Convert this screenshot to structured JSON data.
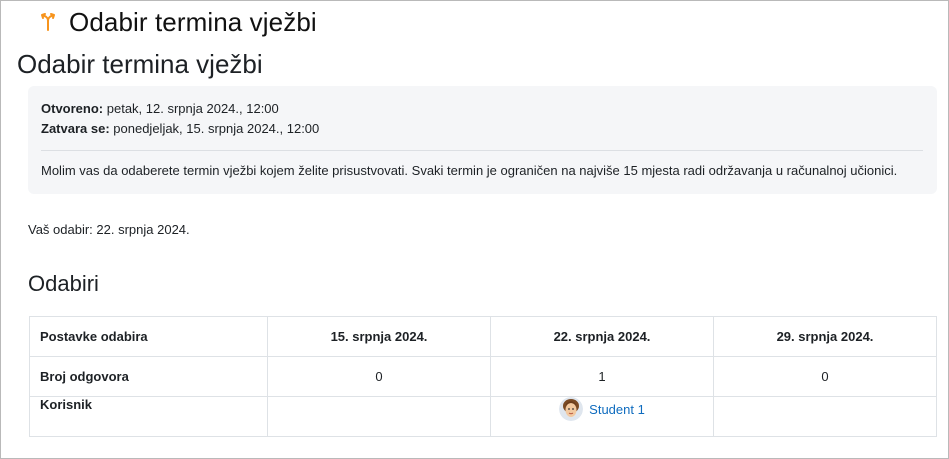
{
  "header": {
    "icon": "choice-icon",
    "title": "Odabir termina vježbi"
  },
  "activity": {
    "title": "Odabir termina vježbi",
    "dates": {
      "opened_label": "Otvoreno:",
      "opened_value": "petak, 12. srpnja 2024., 12:00",
      "closes_label": "Zatvara se:",
      "closes_value": "ponedjeljak, 15. srpnja 2024., 12:00"
    },
    "description": "Molim vas da odaberete termin vježbi kojem želite prisustvovati. Svaki termin je ograničen na najviše 15 mjesta radi održavanja u računalnoj učionici.",
    "your_selection": "Vaš odabir: 22. srpnja 2024."
  },
  "results": {
    "title": "Odabiri",
    "header_label": "Postavke odabira",
    "options": [
      "15. srpnja 2024.",
      "22. srpnja 2024.",
      "29. srpnja 2024."
    ],
    "count_label": "Broj odgovora",
    "counts": [
      "0",
      "1",
      "0"
    ],
    "users_label": "Korisnik",
    "users": [
      "",
      "Student 1",
      ""
    ]
  },
  "colors": {
    "accent": "#f7941d",
    "link": "#0f6cbf",
    "info_bg": "#f5f6f8"
  }
}
